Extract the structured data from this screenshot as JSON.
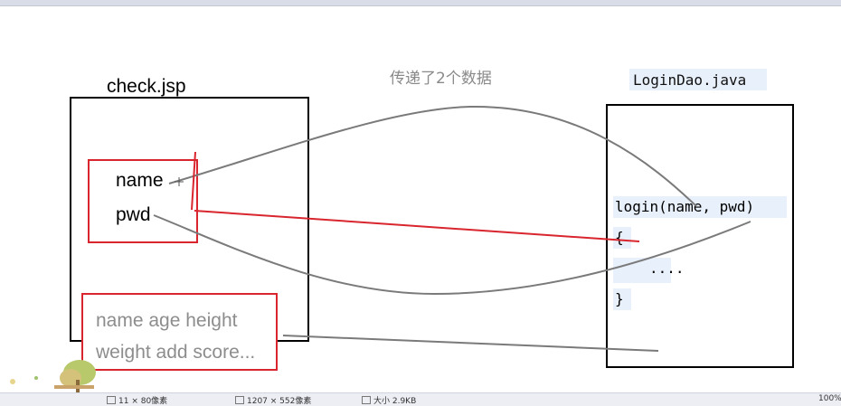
{
  "diagram": {
    "left_title": "check.jsp",
    "middle_note": "传递了2个数据",
    "right_title": "LoginDao.java",
    "params": [
      "name",
      "pwd"
    ],
    "fields_line1": "name  age height",
    "fields_line2": "weight add score...",
    "code": {
      "signature": "login(name, pwd)",
      "open_brace": "{",
      "body": "....",
      "close_brace": "}"
    }
  },
  "statusbar": {
    "selection_size": "11 × 80像素",
    "image_size": "1207 × 552像素",
    "file_size": "大小 2.9KB",
    "zoom": "100%"
  },
  "colors": {
    "red_marker": "#d9262e",
    "gray_line": "#7a7a7a",
    "code_highlight": "#e8f0fb"
  }
}
